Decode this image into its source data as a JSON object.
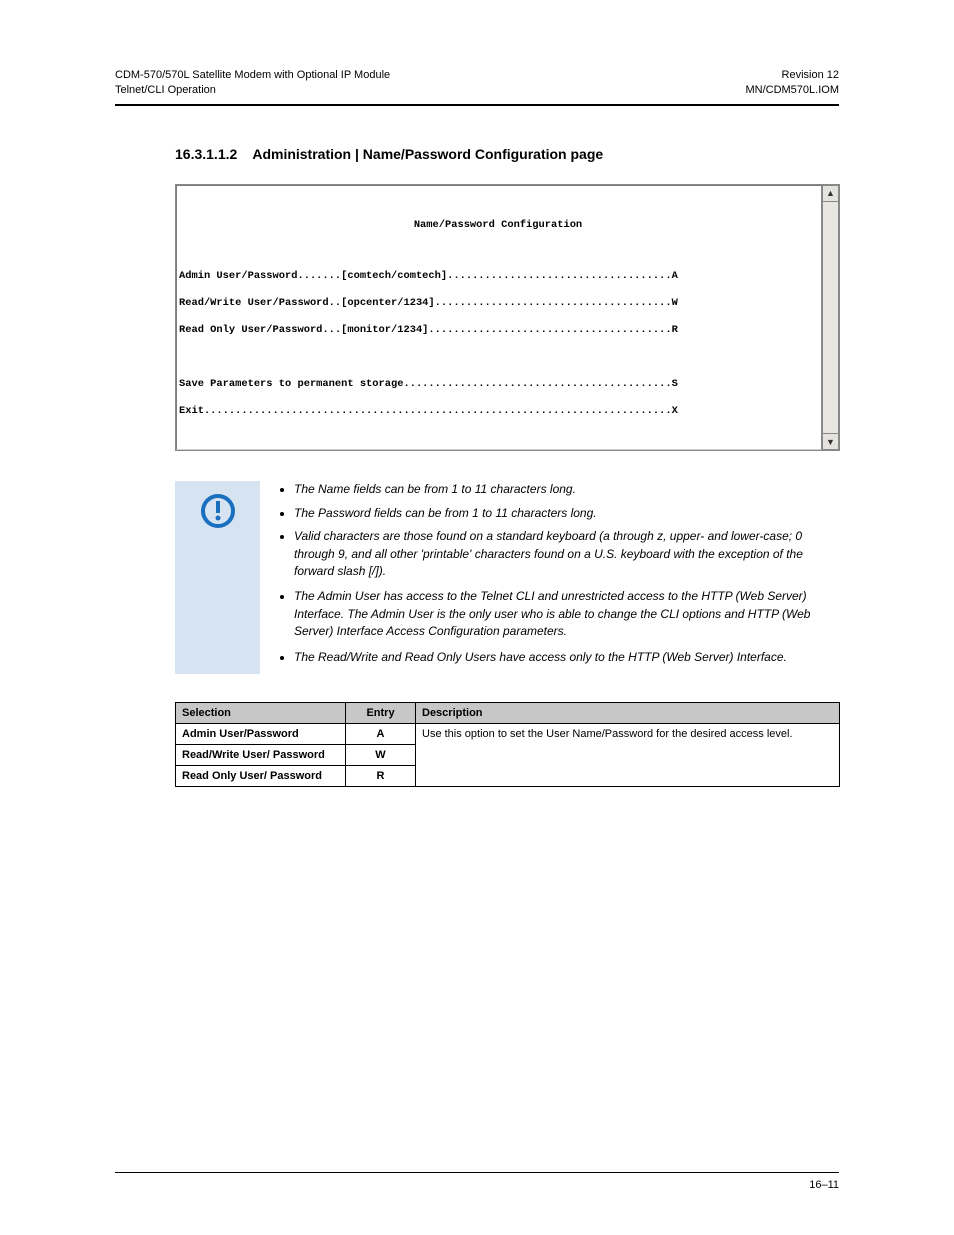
{
  "header": {
    "left_line1": "CDM-570/570L Satellite Modem with Optional IP Module",
    "left_line2": "Telnet/CLI Operation",
    "right_line1": "Revision 12",
    "right_line2": "MN/CDM570L.IOM"
  },
  "section": {
    "number": "16.3.1.1.2",
    "title": "Administration | Name/Password Configuration page"
  },
  "terminal": {
    "title": "Name/Password Configuration",
    "lines": [
      "Admin User/Password.......[comtech/comtech]....................................A",
      "Read/Write User/Password..[opcenter/1234]......................................W",
      "Read Only User/Password...[monitor/1234].......................................R",
      "",
      "",
      "Save Parameters to permanent storage...........................................S",
      "Exit...........................................................................X"
    ]
  },
  "icons": {
    "scroll_up": "▲",
    "scroll_down": "▼"
  },
  "note": {
    "bullets": [
      "The Name fields can be from 1 to 11 characters long.",
      "The Password fields can be from 1 to 11 characters long.",
      "Valid characters are those found on a standard keyboard (a through z, upper- and lower-case; 0 through 9, and all other 'printable' characters found on a U.S. keyboard with the exception of the forward slash [/]).",
      "The Admin User has access to the Telnet CLI and unrestricted access to the HTTP (Web Server) Interface. The Admin User is the only user who is able to change the CLI options and HTTP (Web Server) Interface Access Configuration parameters.",
      "The Read/Write and Read Only Users have access only to the HTTP (Web Server) Interface."
    ]
  },
  "table": {
    "headers": {
      "sel": "Selection",
      "entry": "Entry",
      "desc": "Description"
    },
    "rows": [
      {
        "sel": "Admin User/Password",
        "entry": "A",
        "desc_label": "",
        "desc_text_prefix": "",
        "desc_text": ""
      },
      {
        "sel": "Read/Write User/ Password",
        "entry": "W",
        "desc_text": "Use this option to set the User Name/Password for the desired access level."
      },
      {
        "sel": "Read Only User/ Password",
        "entry": "R",
        "desc_text": ""
      }
    ],
    "merged_desc": "Use this option to set the User Name/Password for the desired access level."
  },
  "footer": {
    "left": "",
    "right": "16–11"
  }
}
